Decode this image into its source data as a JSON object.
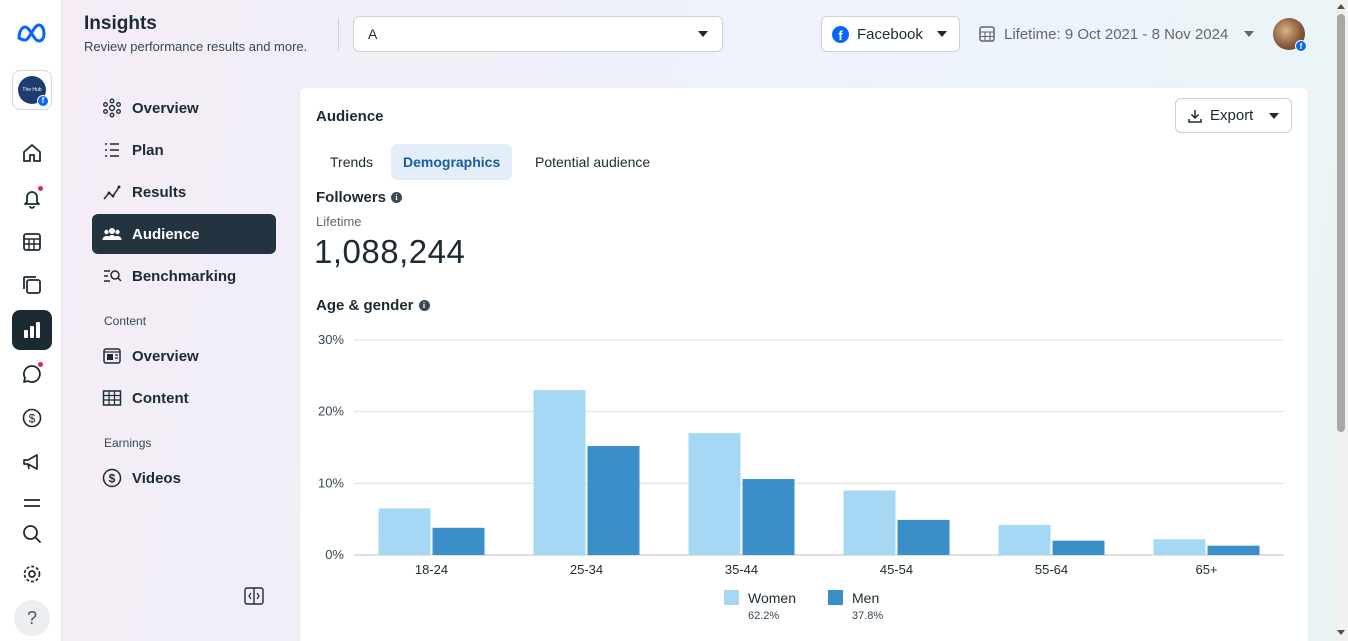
{
  "header": {
    "title": "Insights",
    "subtitle": "Review performance results and more.",
    "account_selector_value": "A",
    "platform": "Facebook",
    "date_range": "Lifetime: 9 Oct 2021 - 8 Nov 2024"
  },
  "rail": {
    "icons": [
      "meta-logo-icon",
      "page-avatar",
      "home-icon",
      "notifications-icon",
      "planner-icon",
      "content-icon",
      "insights-icon",
      "messages-icon",
      "monetization-icon",
      "ads-icon",
      "menu-icon",
      "search-icon",
      "settings-icon",
      "help-icon"
    ],
    "page_avatar_text": "The Hub",
    "help_label": "?"
  },
  "nav": {
    "items": [
      {
        "label": "Overview",
        "icon": "overview-icon"
      },
      {
        "label": "Plan",
        "icon": "plan-icon"
      },
      {
        "label": "Results",
        "icon": "results-icon"
      },
      {
        "label": "Audience",
        "icon": "audience-icon",
        "active": true
      },
      {
        "label": "Benchmarking",
        "icon": "benchmarking-icon"
      }
    ],
    "content_section": "Content",
    "content_items": [
      {
        "label": "Overview",
        "icon": "content-overview-icon"
      },
      {
        "label": "Content",
        "icon": "content-table-icon"
      }
    ],
    "earnings_section": "Earnings",
    "earnings_items": [
      {
        "label": "Videos",
        "icon": "dollar-icon"
      }
    ]
  },
  "card": {
    "title": "Audience",
    "export_label": "Export",
    "tabs": [
      {
        "label": "Trends"
      },
      {
        "label": "Demographics",
        "active": true
      },
      {
        "label": "Potential audience"
      }
    ],
    "followers_heading": "Followers",
    "followers_period": "Lifetime",
    "followers_count": "1,088,244",
    "age_gender_heading": "Age & gender"
  },
  "colors": {
    "women": "#a4d8f5",
    "men": "#3a8fc8",
    "active_nav": "#243340",
    "active_tab_text": "#1a5d9e"
  },
  "chart_data": {
    "type": "bar",
    "categories": [
      "18-24",
      "25-34",
      "35-44",
      "45-54",
      "55-64",
      "65+"
    ],
    "series": [
      {
        "name": "Women",
        "values": [
          6.5,
          23.0,
          17.0,
          9.0,
          4.2,
          2.2
        ],
        "share": "62.2%"
      },
      {
        "name": "Men",
        "values": [
          3.8,
          15.2,
          10.6,
          4.9,
          2.0,
          1.3
        ],
        "share": "37.8%"
      }
    ],
    "yticks": [
      "0%",
      "10%",
      "20%",
      "30%"
    ],
    "ylim": [
      0,
      30
    ],
    "grid": true,
    "legend": "bottom-center"
  }
}
